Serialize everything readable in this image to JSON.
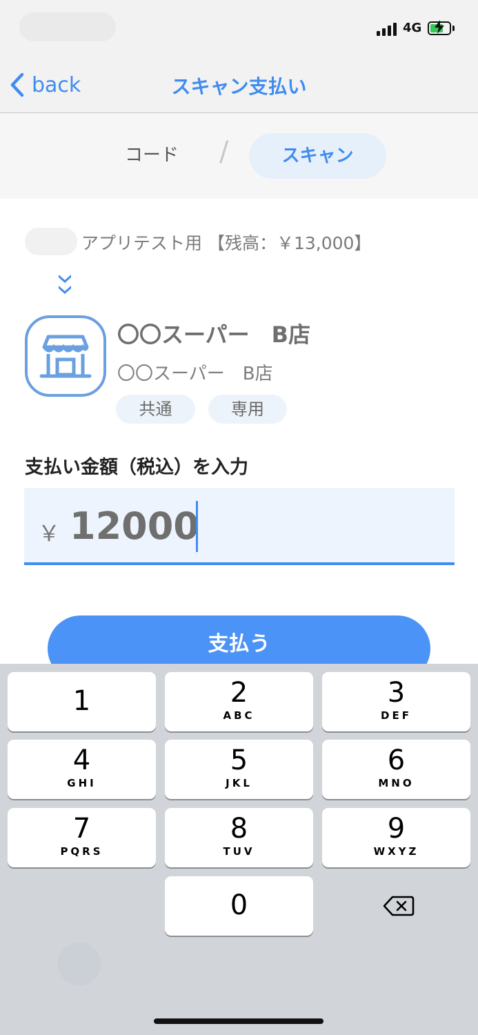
{
  "status": {
    "network": "4G"
  },
  "nav": {
    "back_label": "back",
    "title": "スキャン支払い"
  },
  "tabs": {
    "code_label": "コード",
    "divider": "/",
    "scan_label": "スキャン",
    "active": "scan"
  },
  "account": {
    "label": "アプリテスト用 【残高：￥13,000】"
  },
  "store": {
    "name": "〇〇スーパー　B店",
    "subname": "〇〇スーパー　B店",
    "tags": [
      "共通",
      "専用"
    ],
    "icon": "store-icon"
  },
  "payment": {
    "label": "支払い金額（税込）を入力",
    "currency": "￥",
    "amount": "12000",
    "button_label": "支払う"
  },
  "keypad": {
    "keys": [
      {
        "num": "1",
        "letters": ""
      },
      {
        "num": "2",
        "letters": "ABC"
      },
      {
        "num": "3",
        "letters": "DEF"
      },
      {
        "num": "4",
        "letters": "GHI"
      },
      {
        "num": "5",
        "letters": "JKL"
      },
      {
        "num": "6",
        "letters": "MNO"
      },
      {
        "num": "7",
        "letters": "PQRS"
      },
      {
        "num": "8",
        "letters": "TUV"
      },
      {
        "num": "9",
        "letters": "WXYZ"
      },
      {
        "num": "0",
        "letters": ""
      }
    ],
    "delete_icon": "backspace-icon"
  },
  "colors": {
    "accent": "#3f8cf0",
    "button": "#4b93f6",
    "field_bg": "#eef4fd",
    "keypad_bg": "#d1d4d9"
  }
}
